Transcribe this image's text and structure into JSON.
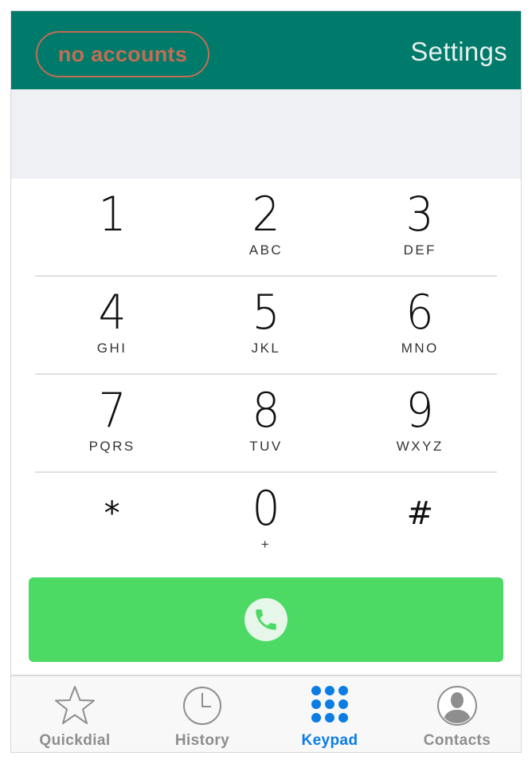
{
  "header": {
    "accounts_label": "no accounts",
    "settings_label": "Settings"
  },
  "keypad": {
    "rows": [
      [
        {
          "digit": "1",
          "letters": ""
        },
        {
          "digit": "2",
          "letters": "ABC"
        },
        {
          "digit": "3",
          "letters": "DEF"
        }
      ],
      [
        {
          "digit": "4",
          "letters": "GHI"
        },
        {
          "digit": "5",
          "letters": "JKL"
        },
        {
          "digit": "6",
          "letters": "MNO"
        }
      ],
      [
        {
          "digit": "7",
          "letters": "PQRS"
        },
        {
          "digit": "8",
          "letters": "TUV"
        },
        {
          "digit": "9",
          "letters": "WXYZ"
        }
      ],
      [
        {
          "digit": "*",
          "letters": ""
        },
        {
          "digit": "0",
          "letters": "+"
        },
        {
          "digit": "#",
          "letters": ""
        }
      ]
    ]
  },
  "call_button": {
    "icon": "phone-icon"
  },
  "tabs": [
    {
      "label": "Quickdial",
      "icon": "star-icon",
      "active": false
    },
    {
      "label": "History",
      "icon": "clock-icon",
      "active": false
    },
    {
      "label": "Keypad",
      "icon": "keypad-grid-icon",
      "active": true
    },
    {
      "label": "Contacts",
      "icon": "person-icon",
      "active": false
    }
  ],
  "colors": {
    "header_bg": "#007a6a",
    "accounts_accent": "#c26d55",
    "call_green": "#4cd964",
    "active_tab_blue": "#0b7de3",
    "inactive_tab_gray": "#8e8e8e"
  }
}
